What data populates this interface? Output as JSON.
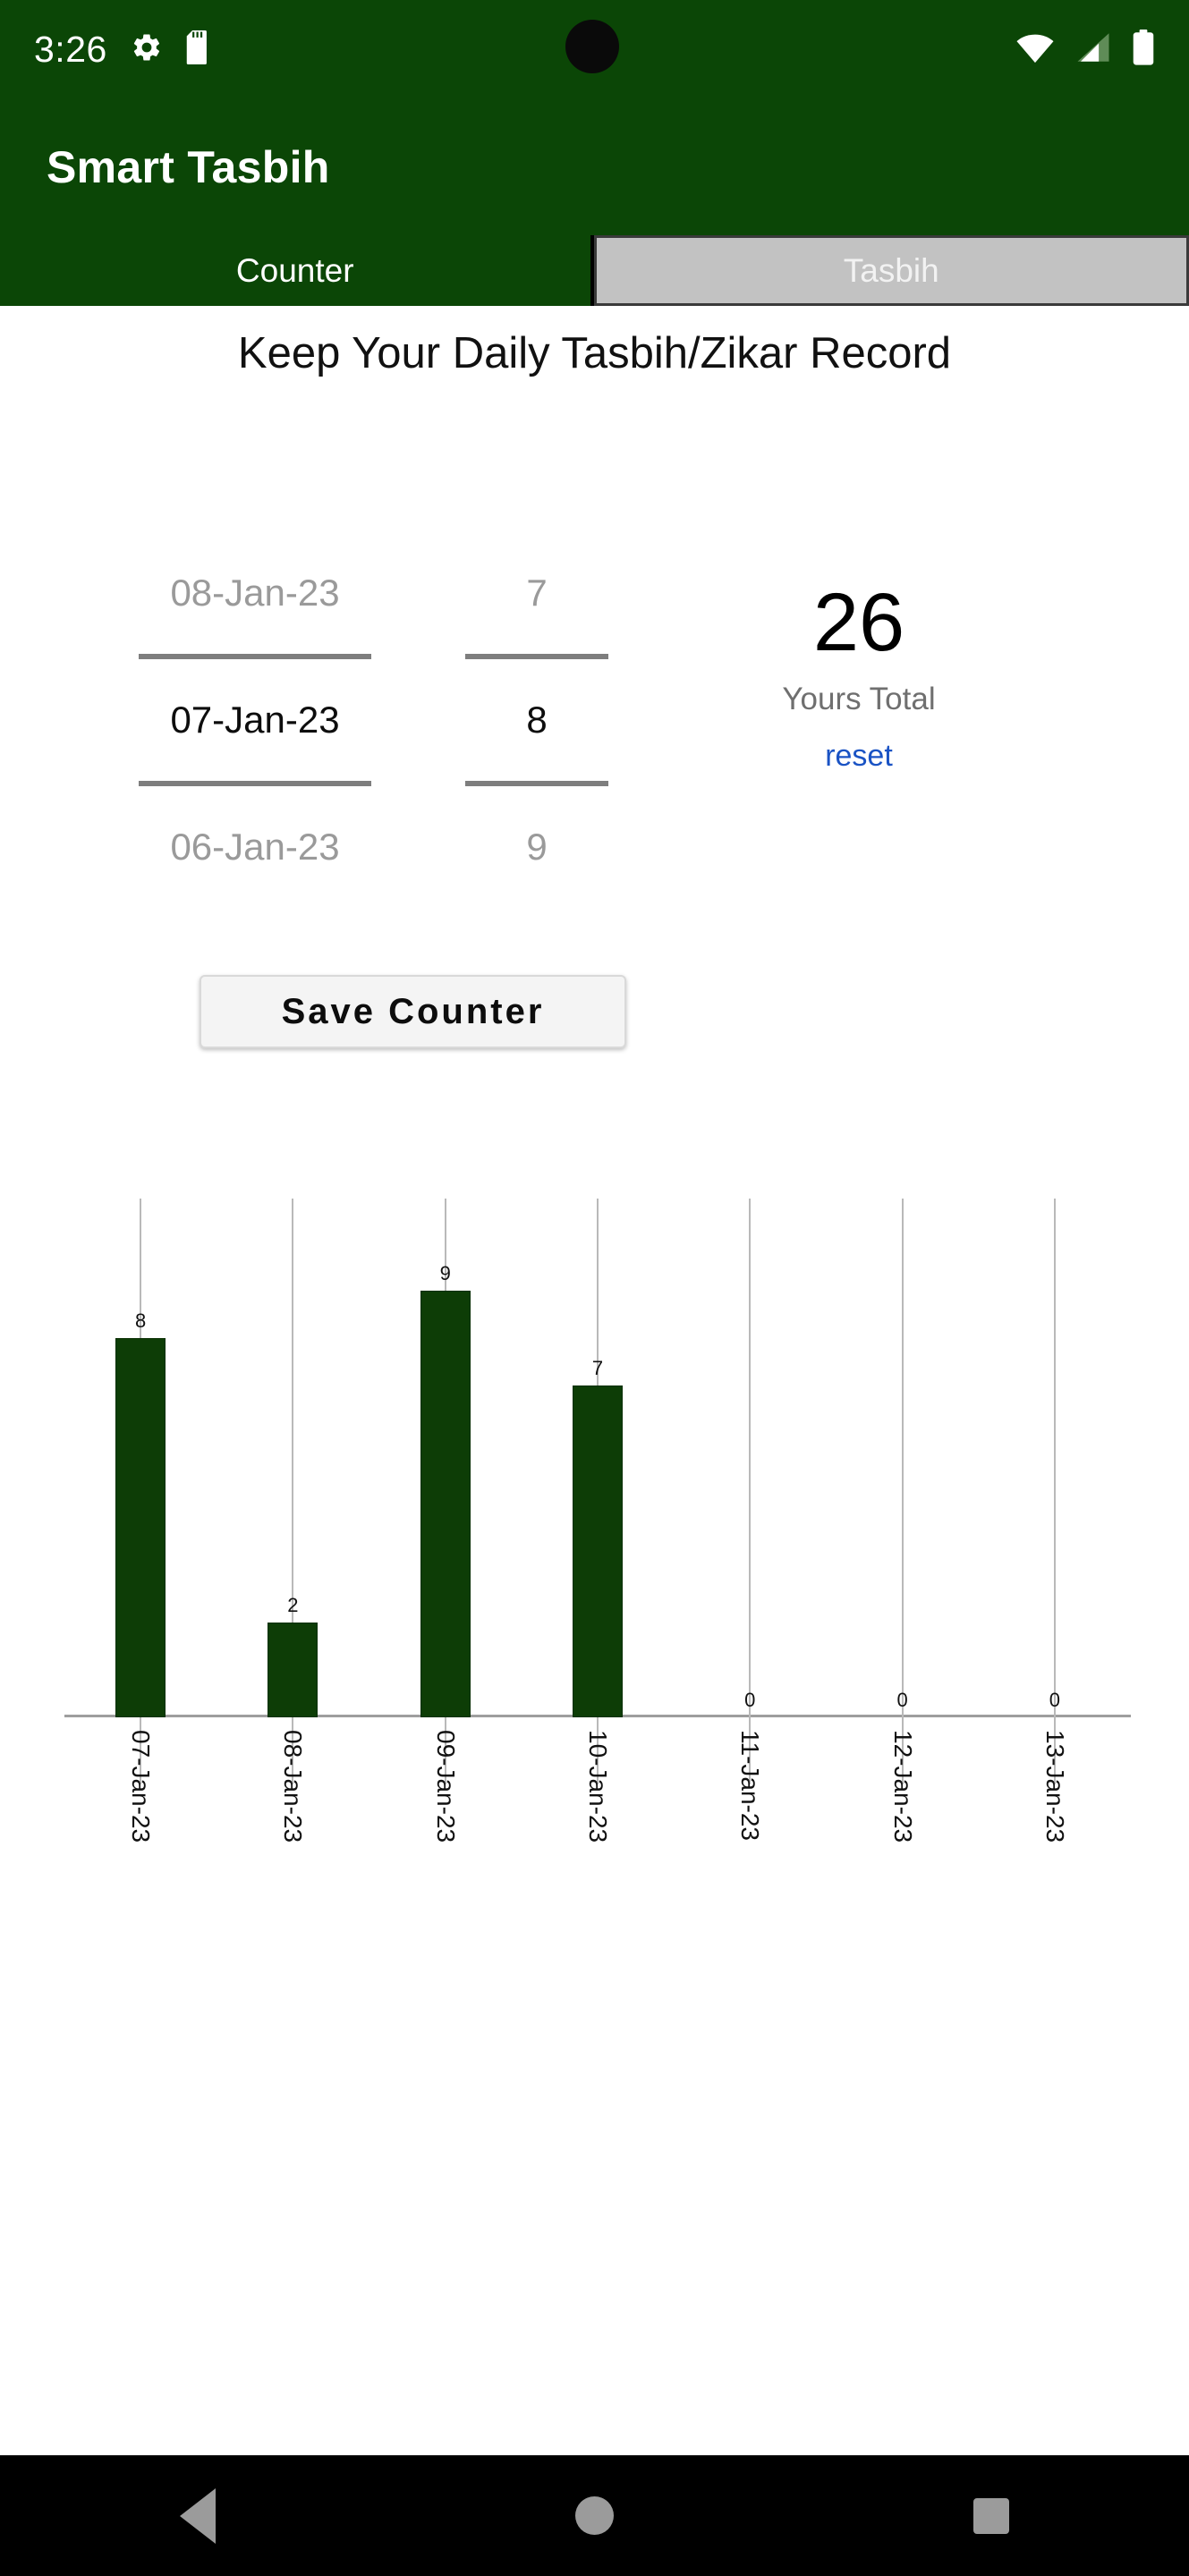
{
  "status_bar": {
    "time": "3:26",
    "left_icons": [
      "gear-icon",
      "sd-card-icon"
    ],
    "right_icons": [
      "wifi-icon",
      "cellular-signal-icon",
      "battery-icon"
    ]
  },
  "app_bar": {
    "title": "Smart Tasbih"
  },
  "tabs": [
    {
      "label": "Counter",
      "selected": false
    },
    {
      "label": "Tasbih",
      "selected": true
    }
  ],
  "heading": "Keep Your Daily Tasbih/Zikar Record",
  "date_picker": {
    "previous": "08-Jan-23",
    "selected": "07-Jan-23",
    "next": "06-Jan-23"
  },
  "count_picker": {
    "previous": "7",
    "selected": "8",
    "next": "9"
  },
  "total": {
    "value": "26",
    "label": "Yours Total",
    "reset_label": "reset"
  },
  "save_button": {
    "label": "Save Counter"
  },
  "chart_data": {
    "type": "bar",
    "title": "",
    "xlabel": "",
    "ylabel": "",
    "grid": true,
    "legend": "none",
    "ylim": [
      0,
      10
    ],
    "categories": [
      "07-Jan-23",
      "08-Jan-23",
      "09-Jan-23",
      "10-Jan-23",
      "11-Jan-23",
      "12-Jan-23",
      "13-Jan-23"
    ],
    "values": [
      8,
      2,
      9,
      7,
      0,
      0,
      0
    ],
    "point_labels": [
      "8",
      "2",
      "9",
      "7",
      "0",
      "0",
      "0"
    ],
    "bar_color": "#0d3d06"
  },
  "nav_bar": {
    "items": [
      "back-icon",
      "home-icon",
      "recents-icon"
    ]
  },
  "colors": {
    "brand_green": "#0b4606",
    "bar_green": "#0d3d06",
    "link_blue": "#1a53c4",
    "tab_selected_bg": "#c2c2c2"
  }
}
